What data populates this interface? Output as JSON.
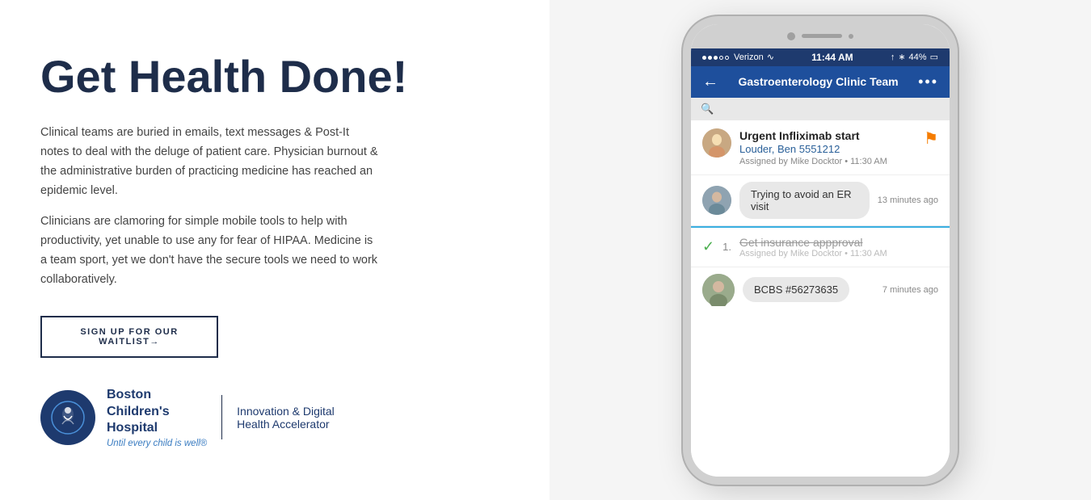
{
  "left": {
    "heading": "Get Health Done!",
    "paragraph1": "Clinical teams are buried in emails, text messages & Post-It notes to deal with the deluge of patient care. Physician burnout & the administrative burden of practicing medicine has reached an epidemic level.",
    "paragraph2": "Clinicians are clamoring for simple mobile tools to help with productivity, yet unable to use any for fear of HIPAA. Medicine is a team sport, yet we don't have the secure tools we need to work collaboratively.",
    "waitlist_btn": "SIGN UP FOR OUR WAITLIST→",
    "hospital_name": "Boston\nChildren's\nHospital",
    "hospital_subtitle": "Innovation & Digital\nHealth Accelerator",
    "hospital_tagline": "Until every child is well®"
  },
  "phone": {
    "status": {
      "carrier": "Verizon",
      "time": "11:44 AM",
      "battery": "44%"
    },
    "nav_title": "Gastroenterology Clinic Team",
    "search_placeholder": "🔍",
    "task1": {
      "title": "Urgent Infliximab start",
      "link": "Louder, Ben 5551212",
      "meta": "Assigned by Mike Docktor  •  11:30 AM"
    },
    "message1": {
      "text": "Trying to avoid an ER visit",
      "time": "13 minutes ago"
    },
    "task2": {
      "number": "1.",
      "title": "Get insurance appproval",
      "meta": "Assigned by Mike Docktor  •  11:30 AM"
    },
    "message2": {
      "text": "BCBS #56273635",
      "time": "7 minutes ago"
    }
  }
}
